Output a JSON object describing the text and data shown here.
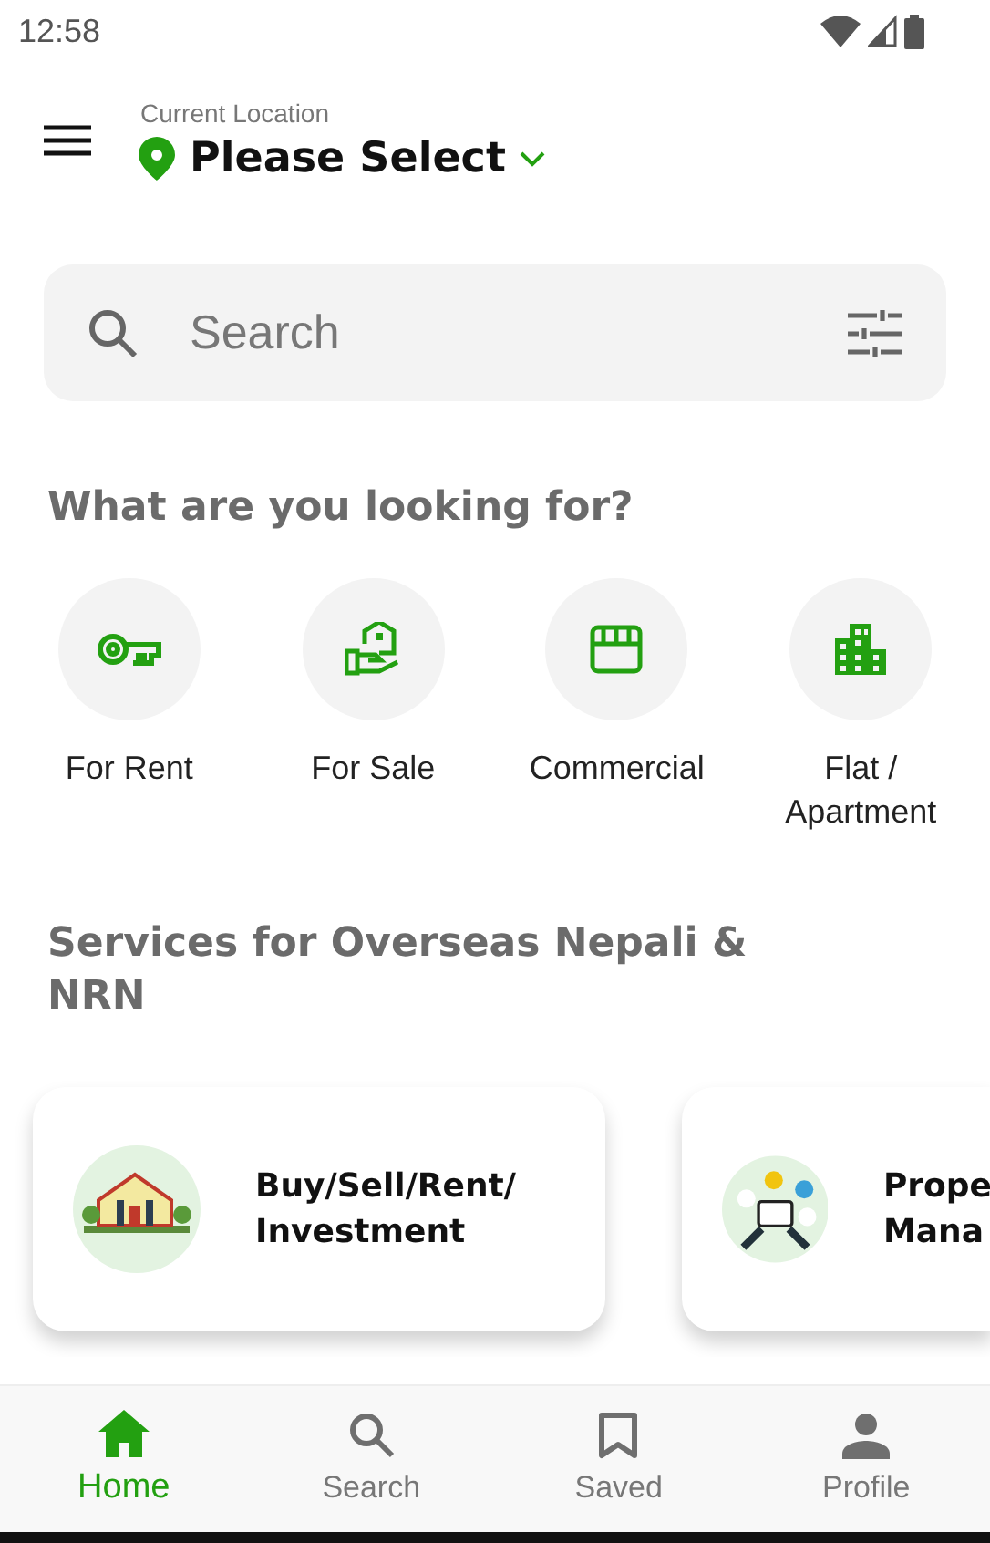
{
  "status_bar": {
    "time": "12:58"
  },
  "header": {
    "caption": "Current Location",
    "location": "Please Select"
  },
  "search": {
    "placeholder": "Search"
  },
  "categories_section": {
    "title": "What are you looking for?",
    "items": [
      {
        "kind": "key",
        "label": "For Rent"
      },
      {
        "kind": "house-hand",
        "label": "For Sale"
      },
      {
        "kind": "store",
        "label": "Commercial"
      },
      {
        "kind": "building",
        "label": "Flat / Apartment"
      }
    ]
  },
  "services_section": {
    "title": "Services for Overseas Nepali  & NRN",
    "cards": [
      {
        "kind": "house",
        "lines": [
          "Buy/Sell/Rent/",
          "Investment"
        ]
      },
      {
        "kind": "tablet",
        "lines": [
          "Prope",
          "Mana"
        ]
      }
    ]
  },
  "bottom_nav": [
    {
      "kind": "home",
      "label": "Home",
      "selected": true
    },
    {
      "kind": "search",
      "label": "Search",
      "selected": false
    },
    {
      "kind": "bookmark",
      "label": "Saved",
      "selected": false
    },
    {
      "kind": "person",
      "label": "Profile",
      "selected": false
    }
  ]
}
